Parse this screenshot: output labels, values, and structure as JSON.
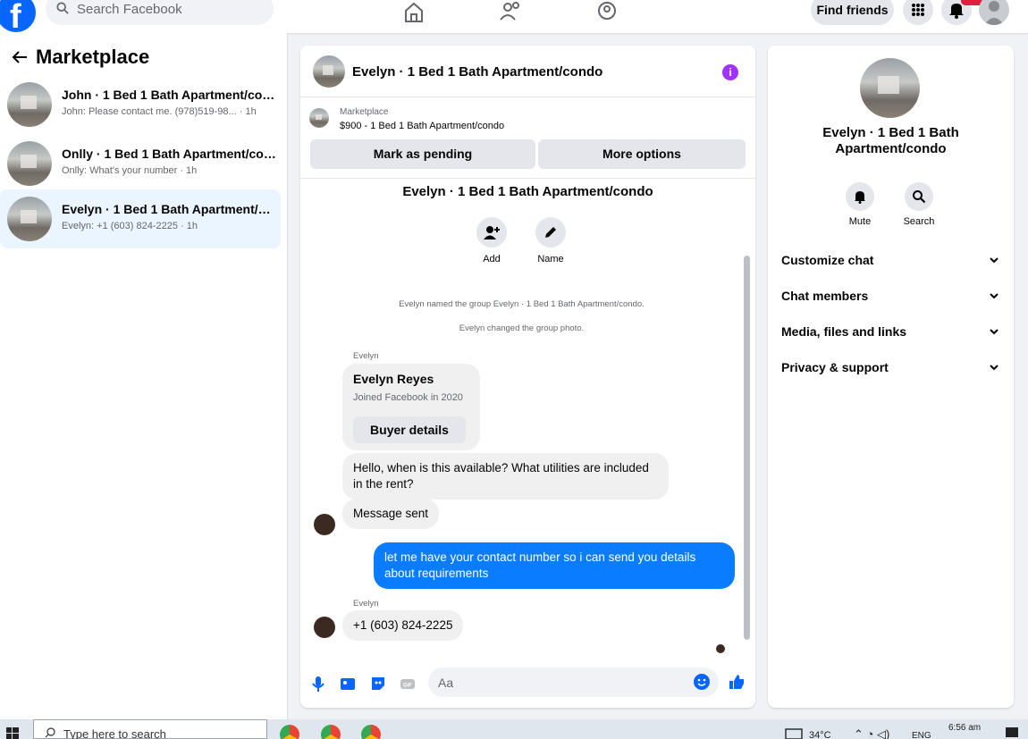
{
  "topbar": {
    "search_placeholder": "Search Facebook",
    "find_friends": "Find friends"
  },
  "sidebar": {
    "title": "Marketplace",
    "conversations": [
      {
        "title": "John · 1 Bed 1 Bath Apartment/condo",
        "preview": "John: Please contact me. (978)519-98...",
        "time": "1h"
      },
      {
        "title": "Onlly · 1 Bed 1 Bath Apartment/condo",
        "preview": "Onlly: What's your number",
        "time": "1h"
      },
      {
        "title": "Evelyn · 1 Bed 1 Bath Apartment/condo",
        "preview": "Evelyn: +1 (603) 824-2225",
        "time": "1h"
      }
    ]
  },
  "chat": {
    "header_title": "Evelyn · 1 Bed 1 Bath Apartment/condo",
    "listing_source": "Marketplace",
    "listing_price": "$900 - 1 Bed 1 Bath Apartment/condo",
    "mark_pending": "Mark as pending",
    "more_options": "More options",
    "group_title": "Evelyn · 1 Bed 1 Bath Apartment/condo",
    "add_label": "Add",
    "name_label": "Name",
    "system_messages": [
      "Evelyn named the group Evelyn · 1 Bed 1 Bath Apartment/condo.",
      "Evelyn changed the group photo."
    ],
    "sender_name": "Evelyn",
    "profile_card": {
      "name": "Evelyn Reyes",
      "joined": "Joined Facebook in 2020",
      "button": "Buyer details"
    },
    "messages": [
      {
        "text": "Hello, when is this available? What utilities are included in the rent?"
      },
      {
        "text": "Message sent"
      },
      {
        "text": "let me have your contact number so i can send you details about requirements"
      },
      {
        "text": "+1 (603) 824-2225"
      }
    ],
    "composer_placeholder": "Aa"
  },
  "details": {
    "name": "Evelyn · 1 Bed 1 Bath Apartment/condo",
    "mute": "Mute",
    "search": "Search",
    "sections": [
      "Customize chat",
      "Chat members",
      "Media, files and links",
      "Privacy & support"
    ]
  },
  "taskbar": {
    "search_placeholder": "Type here to search",
    "temperature": "34°C",
    "language": "ENG",
    "time": "6:56 am"
  },
  "colors": {
    "facebook_blue": "#0866ff",
    "outgoing_bubble": "#0a7cff",
    "info_purple": "#a033ff",
    "active_row": "#ebf5ff"
  }
}
